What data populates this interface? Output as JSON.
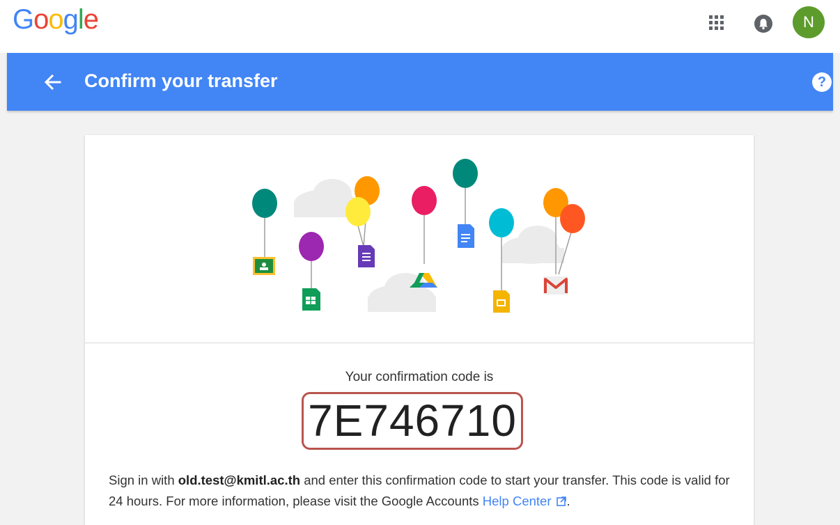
{
  "header": {
    "logo_letters": [
      {
        "char": "G",
        "color": "#4285f4"
      },
      {
        "char": "o",
        "color": "#ea4335"
      },
      {
        "char": "o",
        "color": "#fbbc05"
      },
      {
        "char": "g",
        "color": "#4285f4"
      },
      {
        "char": "l",
        "color": "#34a853"
      },
      {
        "char": "e",
        "color": "#ea4335"
      }
    ],
    "apps_icon": "apps-grid-icon",
    "notifications_icon": "bell-icon",
    "avatar_initial": "N",
    "avatar_color": "#5d9c2c"
  },
  "appbar": {
    "title": "Confirm your transfer",
    "back_icon": "arrow-back-icon",
    "help_icon": "help-icon",
    "help_glyph": "?",
    "color": "#4285f4"
  },
  "main": {
    "illustration_icons": [
      "classroom-icon",
      "sheets-icon",
      "forms-icon",
      "drive-icon",
      "docs-icon",
      "slides-icon",
      "gmail-icon"
    ],
    "code_label": "Your confirmation code is",
    "code": "7E746710",
    "instructions": {
      "part1": "Sign in with ",
      "email": "old.test@kmitl.ac.th",
      "part2": " and enter this confirmation code to start your transfer. This code is valid for 24 hours. For more information, please visit the Google Accounts ",
      "link_text": "Help Center",
      "part3": "."
    }
  }
}
